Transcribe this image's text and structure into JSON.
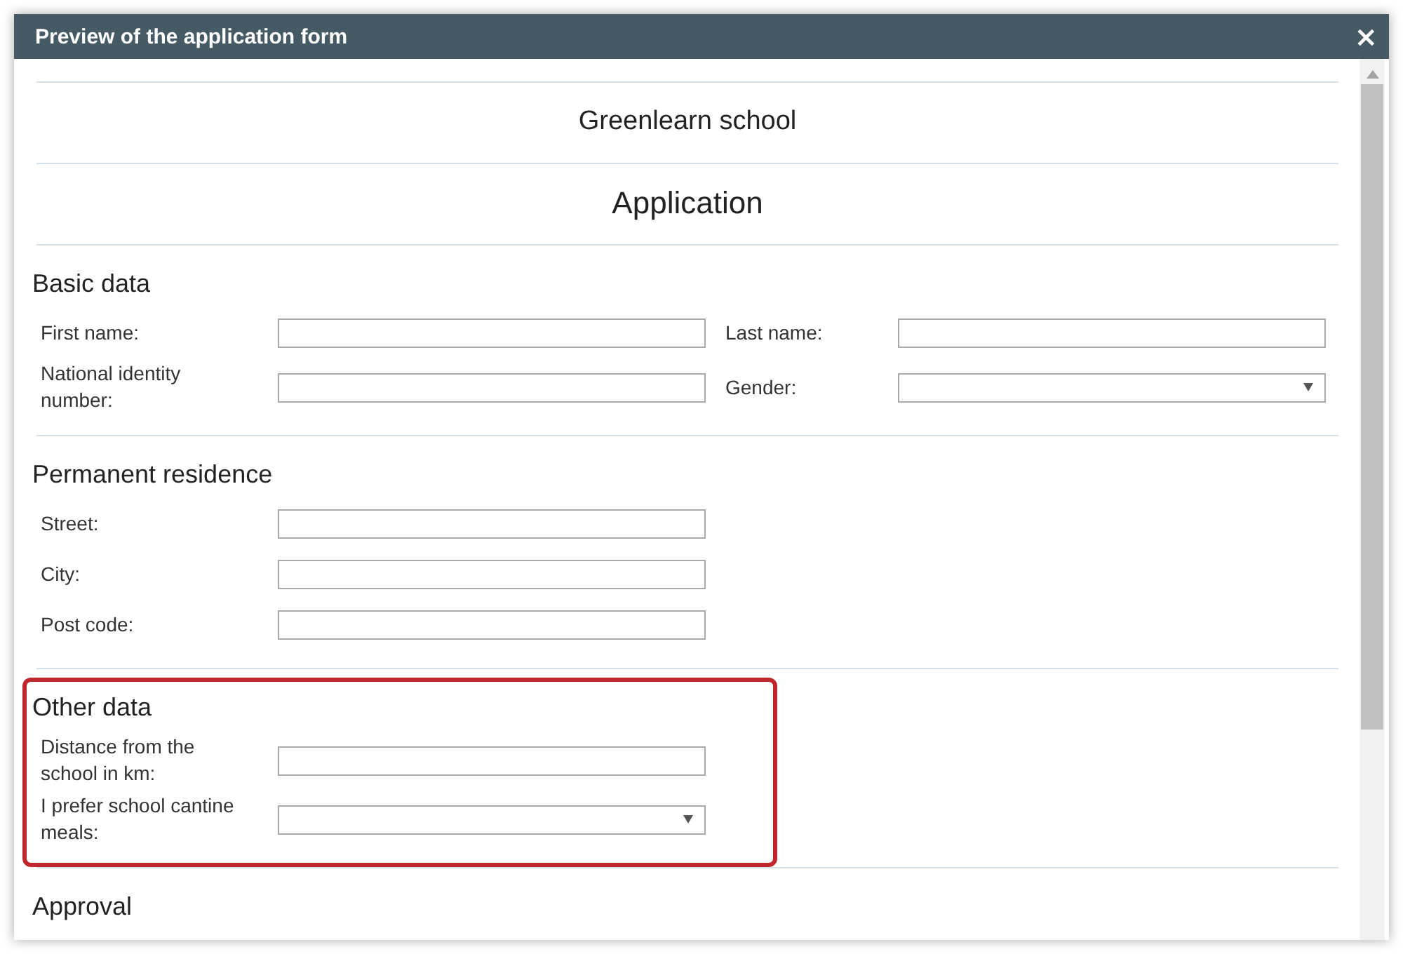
{
  "dialog": {
    "title": "Preview of the application form",
    "close": "×"
  },
  "header": {
    "school": "Greenlearn school",
    "form_title": "Application"
  },
  "sections": [
    {
      "title": "Basic data",
      "highlighted": false,
      "rows": [
        [
          {
            "label": "First name:",
            "kind": "text"
          },
          {
            "label": "Last name:",
            "kind": "text"
          }
        ],
        [
          {
            "label": "National identity number:",
            "kind": "text"
          },
          {
            "label": "Gender:",
            "kind": "select"
          }
        ]
      ]
    },
    {
      "title": "Permanent residence",
      "highlighted": false,
      "rows": [
        [
          {
            "label": "Street:",
            "kind": "text"
          }
        ],
        [
          {
            "label": "City:",
            "kind": "text"
          }
        ],
        [
          {
            "label": "Post code:",
            "kind": "text"
          }
        ]
      ]
    },
    {
      "title": "Other data",
      "highlighted": true,
      "rows": [
        [
          {
            "label": "Distance from the school in km:",
            "kind": "text"
          }
        ],
        [
          {
            "label": "I prefer school cantine meals:",
            "kind": "select"
          }
        ]
      ]
    },
    {
      "title": "Approval",
      "highlighted": false
    }
  ]
}
